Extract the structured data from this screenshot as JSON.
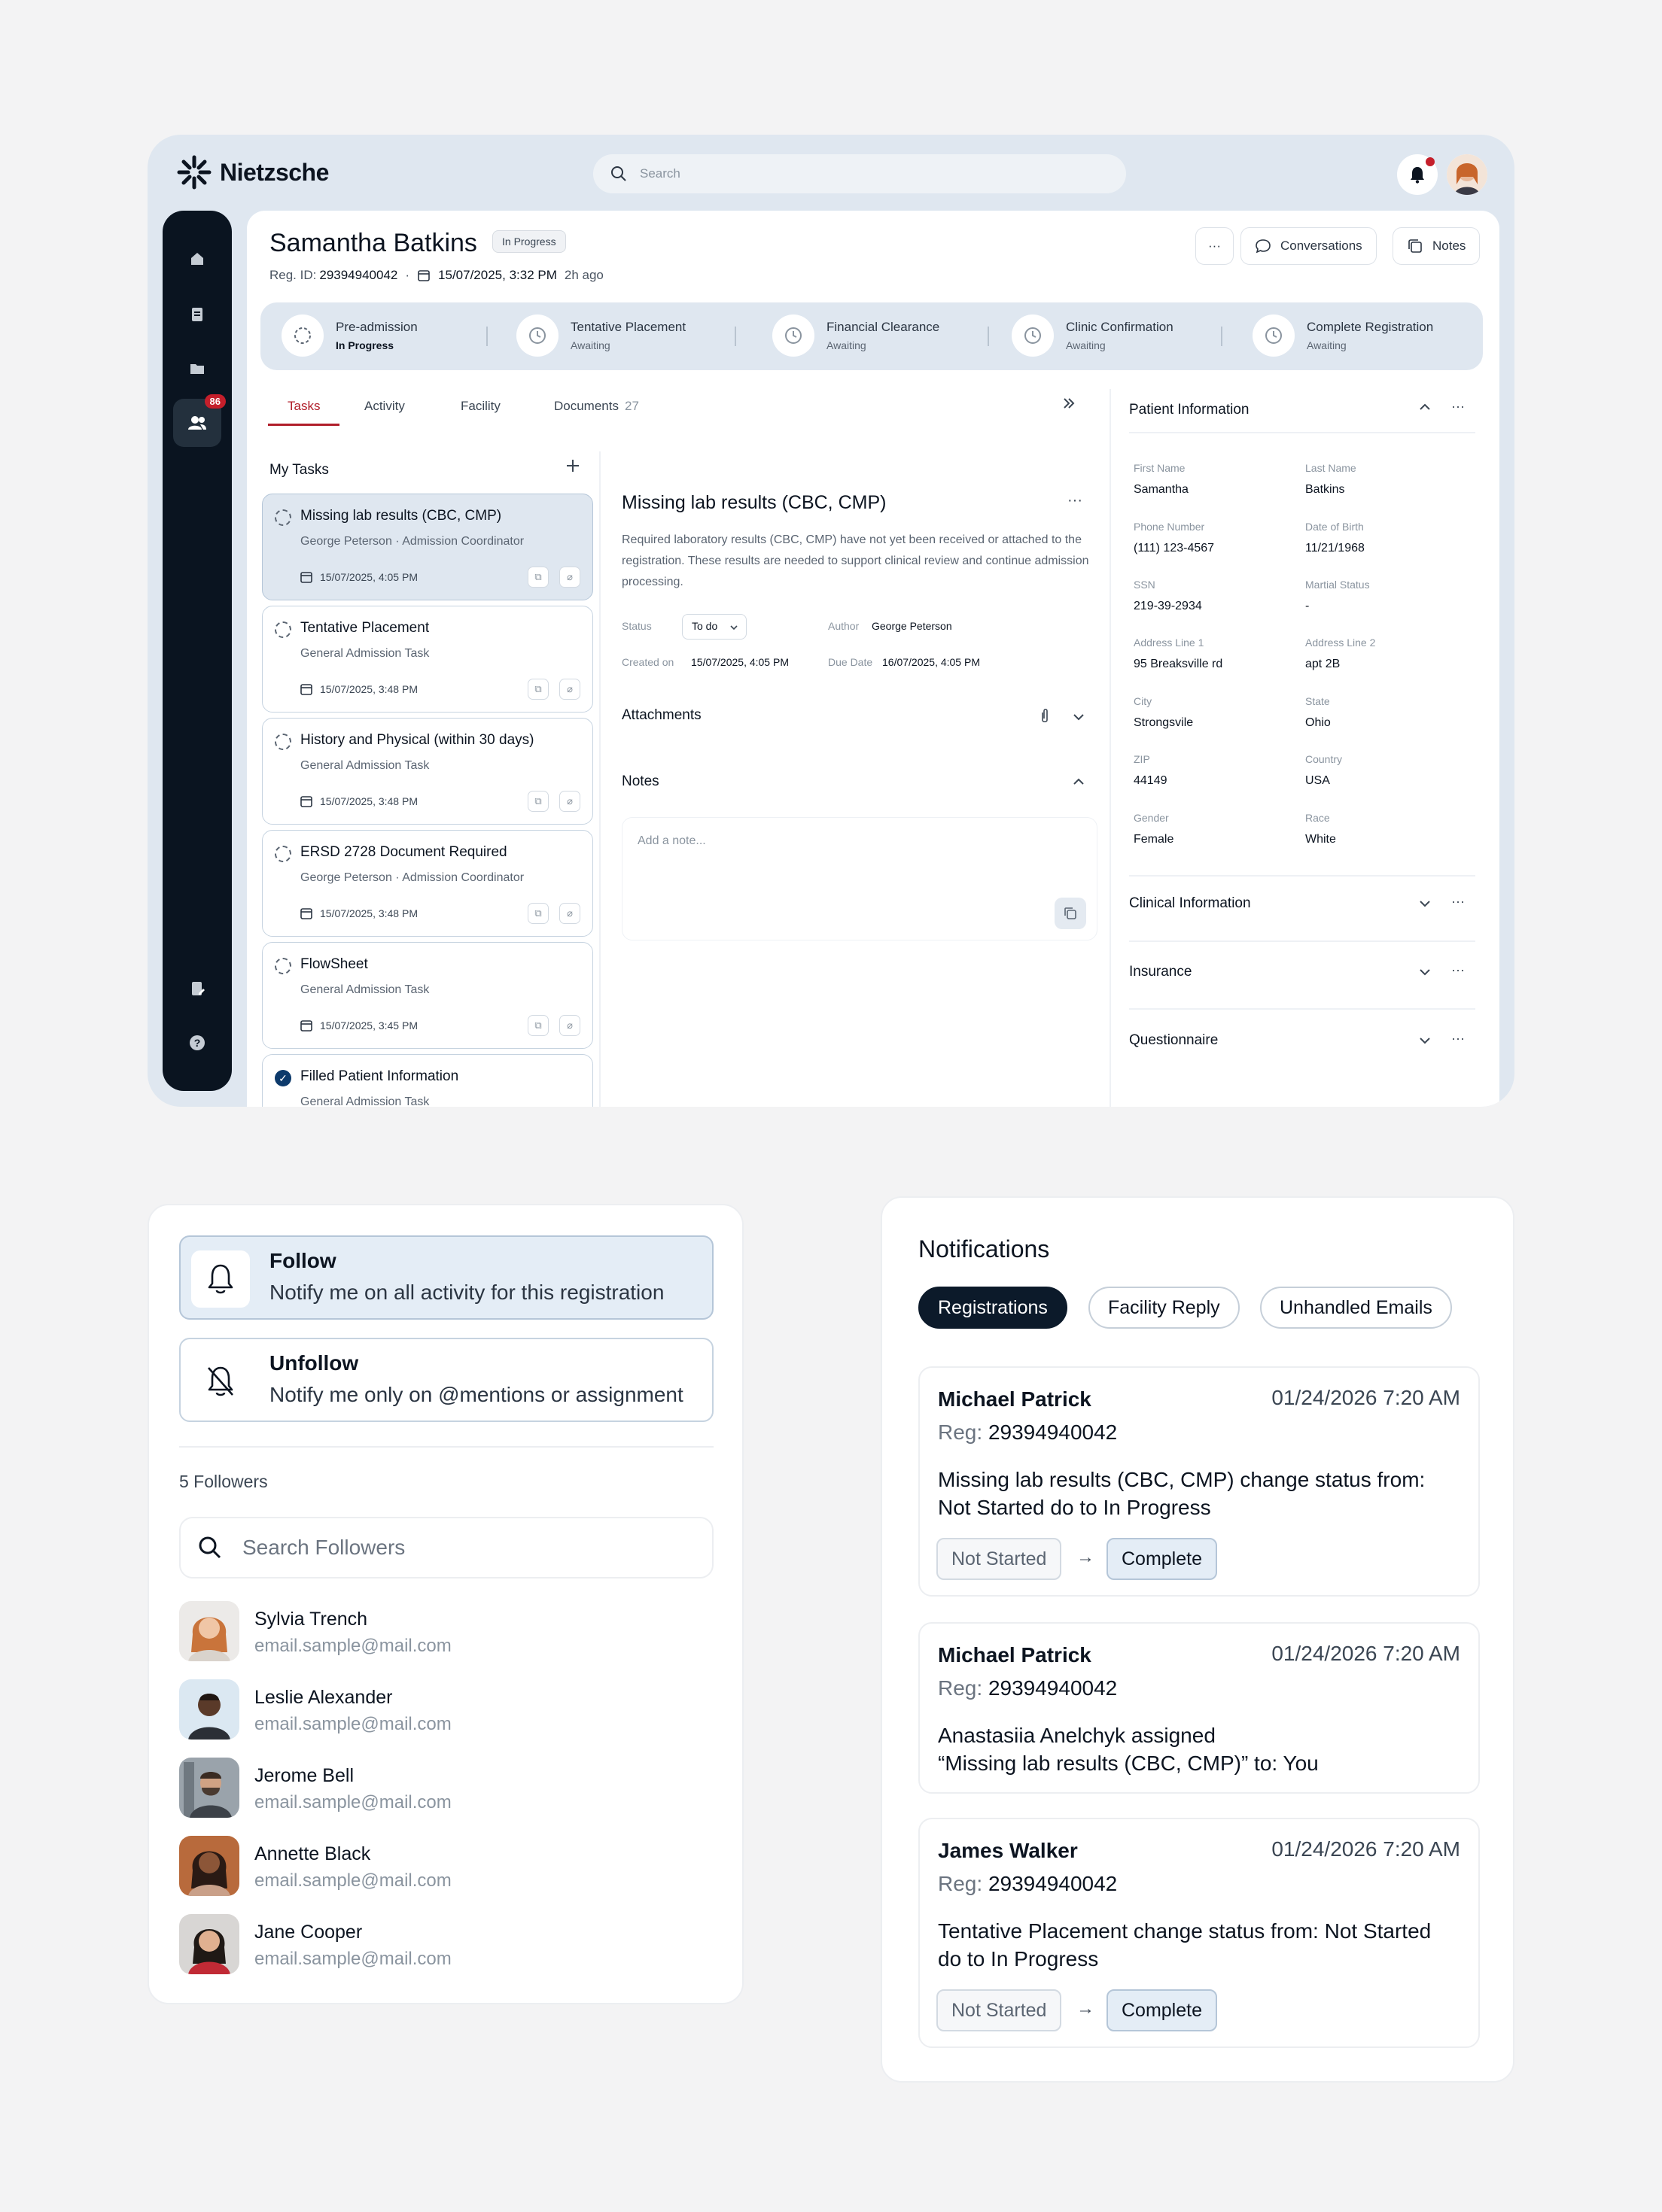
{
  "app": {
    "brand": "Nietzsche",
    "search_placeholder": "Search",
    "nav_badge": "86"
  },
  "patient_header": {
    "name": "Samantha Batkins",
    "status": "In Progress",
    "reg_label": "Reg. ID:",
    "reg_id": "29394940042",
    "bullet": "·",
    "datetime": "15/07/2025, 3:32 PM",
    "ago": "2h ago",
    "more": "···",
    "conversations": "Conversations",
    "notes": "Notes"
  },
  "steps": [
    {
      "title": "Pre-admission",
      "status": "In Progress"
    },
    {
      "title": "Tentative Placement",
      "status": "Awaiting"
    },
    {
      "title": "Financial Clearance",
      "status": "Awaiting"
    },
    {
      "title": "Clinic Confirmation",
      "status": "Awaiting"
    },
    {
      "title": "Complete Registration",
      "status": "Awaiting"
    }
  ],
  "tabs": [
    {
      "label": "Tasks"
    },
    {
      "label": "Activity"
    },
    {
      "label": "Facility"
    },
    {
      "label": "Documents",
      "count": "27"
    }
  ],
  "tasks_header": "My Tasks",
  "tasks": [
    {
      "title": "Missing lab results (CBC, CMP)",
      "sub": "George Peterson · Admission Coordinator",
      "date": "15/07/2025, 4:05 PM"
    },
    {
      "title": "Tentative Placement",
      "sub": "General Admission Task",
      "date": "15/07/2025, 3:48 PM"
    },
    {
      "title": "History and Physical (within 30 days)",
      "sub": "General Admission Task",
      "date": "15/07/2025, 3:48 PM"
    },
    {
      "title": "ERSD 2728 Document Required",
      "sub": "George Peterson · Admission Coordinator",
      "date": "15/07/2025, 3:48 PM"
    },
    {
      "title": "FlowSheet",
      "sub": "General Admission Task",
      "date": "15/07/2025, 3:45 PM"
    },
    {
      "title": "Filled Patient Information",
      "sub": "General Admission Task"
    }
  ],
  "detail": {
    "title": "Missing lab results (CBC, CMP)",
    "description": "Required laboratory results (CBC, CMP) have not yet been received or attached to the registration. These results are needed to support clinical review and continue admission processing.",
    "status_label": "Status",
    "status_value": "To do",
    "author_label": "Author",
    "author_value": "George Peterson",
    "created_label": "Created on",
    "created_value": "15/07/2025, 4:05 PM",
    "due_label": "Due Date",
    "due_value": "16/07/2025, 4:05 PM",
    "attachments": "Attachments",
    "notes": "Notes",
    "note_placeholder": "Add a note..."
  },
  "patient_info": {
    "title": "Patient Information",
    "fields": [
      {
        "label": "First Name",
        "value": "Samantha"
      },
      {
        "label": "Last Name",
        "value": "Batkins"
      },
      {
        "label": "Phone Number",
        "value": "(111) 123-4567"
      },
      {
        "label": "Date of Birth",
        "value": "11/21/1968"
      },
      {
        "label": "SSN",
        "value": "219-39-2934"
      },
      {
        "label": "Martial Status",
        "value": "-"
      },
      {
        "label": "Address Line 1",
        "value": "95 Breaksville rd"
      },
      {
        "label": "Address Line 2",
        "value": "apt 2B"
      },
      {
        "label": "City",
        "value": "Strongsvile"
      },
      {
        "label": "State",
        "value": "Ohio"
      },
      {
        "label": "ZIP",
        "value": "44149"
      },
      {
        "label": "Country",
        "value": "USA"
      },
      {
        "label": "Gender",
        "value": "Female"
      },
      {
        "label": "Race",
        "value": "White"
      }
    ],
    "sections": [
      "Clinical Information",
      "Insurance",
      "Questionnaire"
    ]
  },
  "follow": {
    "options": [
      {
        "title": "Follow",
        "desc": "Notify me on all activity for this registration"
      },
      {
        "title": "Unfollow",
        "desc": "Notify me only on @mentions or assignment"
      }
    ],
    "count_label": "5 Followers",
    "search_placeholder": "Search Followers",
    "followers": [
      {
        "name": "Sylvia Trench",
        "email": "email.sample@mail.com"
      },
      {
        "name": "Leslie Alexander",
        "email": "email.sample@mail.com"
      },
      {
        "name": "Jerome Bell",
        "email": "email.sample@mail.com"
      },
      {
        "name": "Annette Black",
        "email": "email.sample@mail.com"
      },
      {
        "name": "Jane Cooper",
        "email": "email.sample@mail.com"
      }
    ]
  },
  "notifications": {
    "title": "Notifications",
    "chips": [
      "Registrations",
      "Facility Reply",
      "Unhandled Emails"
    ],
    "items": [
      {
        "who": "Michael Patrick",
        "when": "01/24/2026 7:20 AM",
        "reg_label": "Reg:",
        "reg": "29394940042",
        "line1": "Missing lab results (CBC, CMP) change status from:",
        "line2": "Not Started do to In Progress",
        "from": "Not Started",
        "to": "Complete"
      },
      {
        "who": "Michael Patrick",
        "when": "01/24/2026 7:20 AM",
        "reg_label": "Reg:",
        "reg": "29394940042",
        "line1": "Anastasiia Anelchyk assigned",
        "line2": "“Missing lab results (CBC, CMP)” to: You"
      },
      {
        "who": "James Walker",
        "when": "01/24/2026 7:20 AM",
        "reg_label": "Reg:",
        "reg": "29394940042",
        "line1": "Tentative Placement change status from: Not Started",
        "line2": "do to In Progress",
        "from": "Not Started",
        "to": "Complete"
      }
    ],
    "arrow": "→"
  },
  "colors": {
    "accent": "#b01e2a",
    "navy": "#0c1a2a",
    "panel_blue": "#dfe7f0"
  }
}
